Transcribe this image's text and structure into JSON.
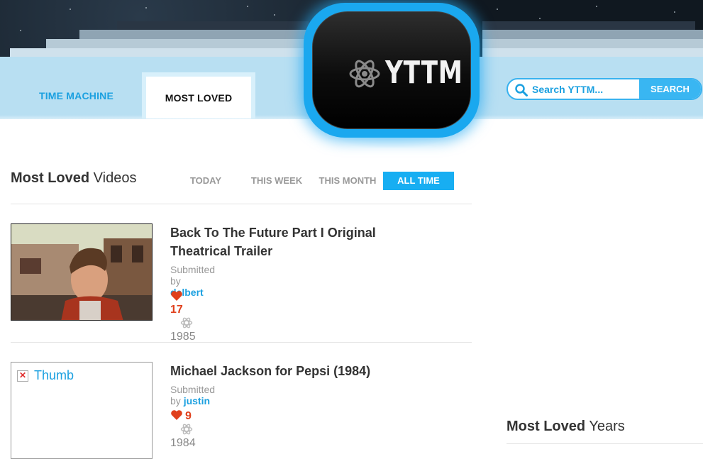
{
  "header": {
    "logo_text": "YTTM",
    "nav": [
      {
        "label": "TIME MACHINE"
      },
      {
        "label": "MOST LOVED"
      }
    ],
    "search": {
      "placeholder": "Search YTTM...",
      "button_label": "SEARCH"
    }
  },
  "main": {
    "title_strong": "Most Loved",
    "title_rest": " Videos",
    "filters": [
      "TODAY",
      "THIS WEEK",
      "THIS MONTH",
      "ALL TIME"
    ],
    "active_filter": "ALL TIME",
    "submitted_prefix": "Submitted by ",
    "videos": [
      {
        "title": "Back To The Future Part I Original Theatrical Trailer",
        "user": "delbert",
        "loves": "17",
        "year": "1985"
      },
      {
        "title": "Michael Jackson for Pepsi (1984)",
        "user": "justin",
        "loves": "9",
        "year": "1984",
        "thumb_alt": "Thumb"
      }
    ]
  },
  "sidebar": {
    "years_title_strong": "Most Loved",
    "years_title_rest": " Years"
  },
  "colors": {
    "accent": "#17aef2",
    "love": "#e0401c",
    "header_band": "#b8dff2"
  }
}
